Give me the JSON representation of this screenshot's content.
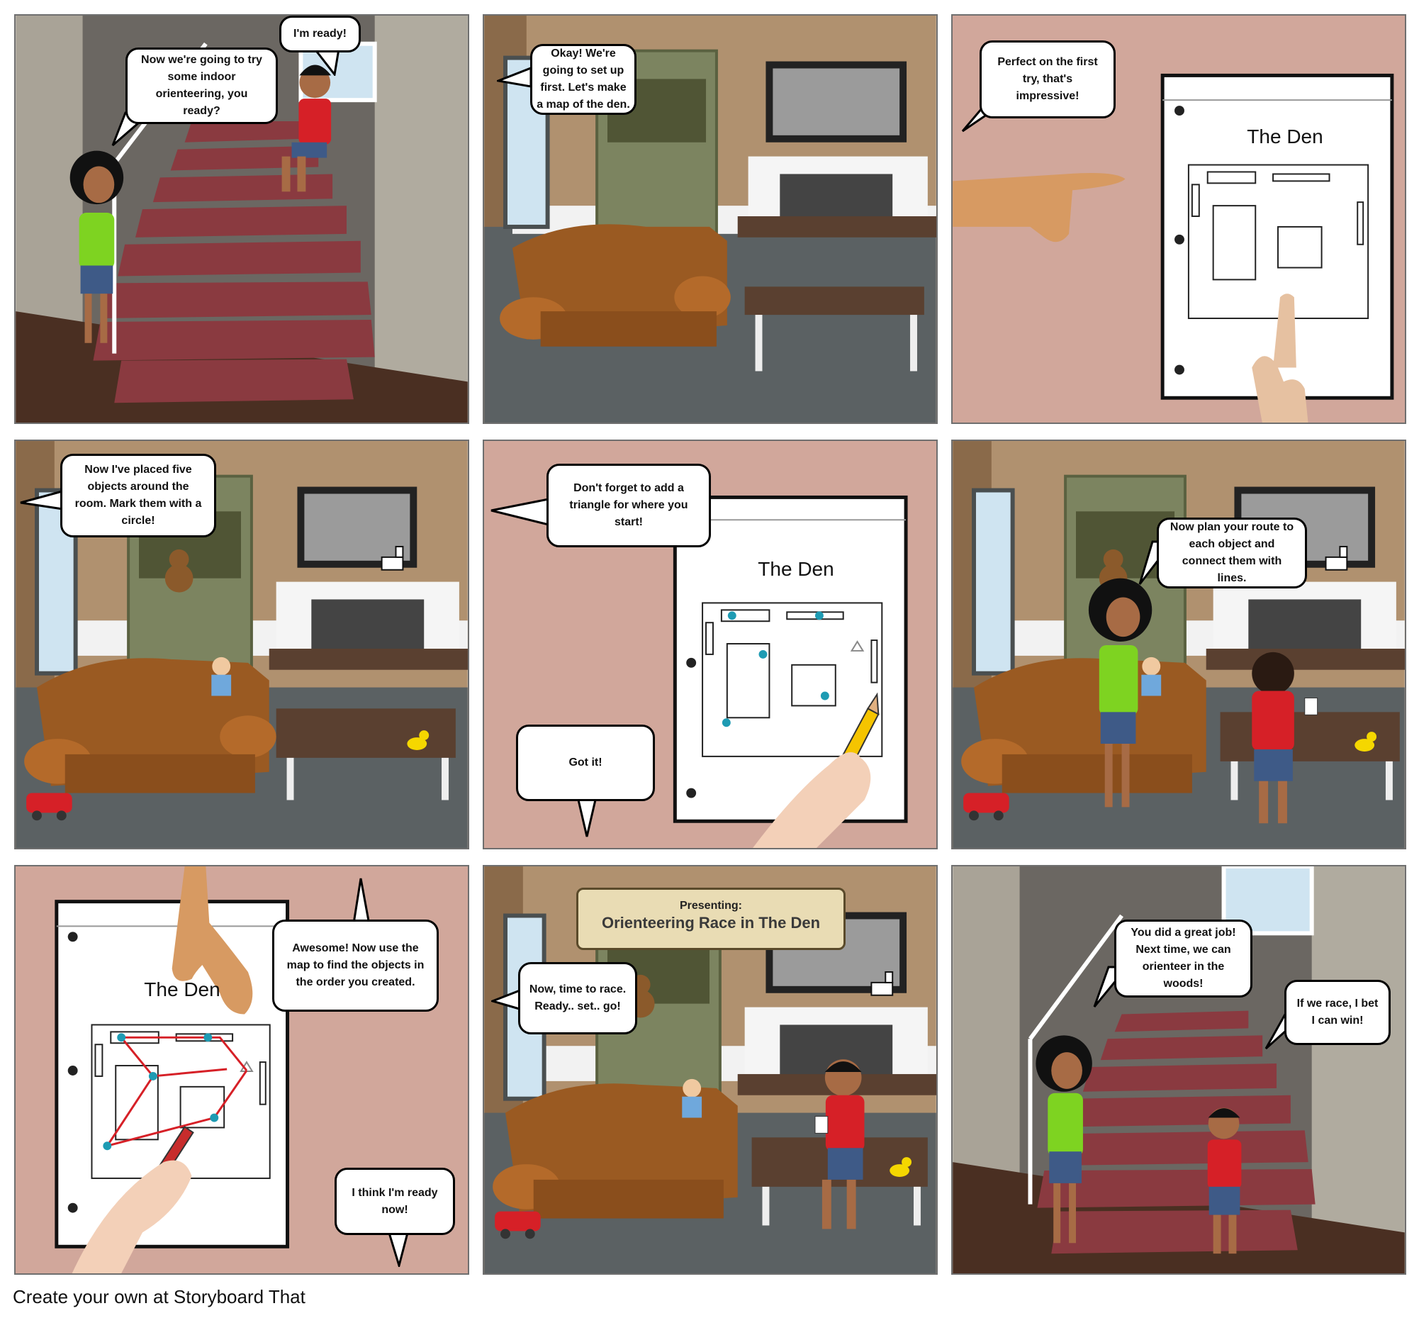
{
  "panels": [
    {
      "bubbles": [
        "Now we're going to try some indoor orienteering, you ready?",
        "I'm ready!"
      ]
    },
    {
      "bubbles": [
        "Okay! We're going to set up first. Let's make a map of the den."
      ]
    },
    {
      "bubbles": [
        "Perfect on the first try, that's impressive!"
      ],
      "map_title": "The Den"
    },
    {
      "bubbles": [
        "Now I've placed five objects around the room. Mark them with a circle!"
      ]
    },
    {
      "bubbles": [
        "Don't forget to add a triangle for where you start!",
        "Got it!"
      ],
      "map_title": "The Den"
    },
    {
      "bubbles": [
        "Now plan your route to each object and connect them with lines."
      ]
    },
    {
      "bubbles": [
        "Awesome! Now use the map to find the objects in the order you created.",
        "I think I'm ready now!"
      ],
      "map_title": "The Den"
    },
    {
      "banner_line1": "Presenting:",
      "banner_line2": "Orienteering Race in The Den",
      "bubbles": [
        "Now, time to race. Ready.. set.. go!"
      ]
    },
    {
      "bubbles": [
        "You did a great job! Next time, we can orienteer in the woods!",
        "If we race, I bet I can win!"
      ]
    }
  ],
  "footer": "Create your own at Storyboard That",
  "colors": {
    "pink_bg": "#d1a79b",
    "wall": "#b0916f",
    "carpet": "#5b6163",
    "stair_red": "#8a3a40",
    "sofa": "#9a5a22",
    "tv": "#9b9b9b",
    "map_dot": "#1e9bb3",
    "route": "#d62027"
  }
}
